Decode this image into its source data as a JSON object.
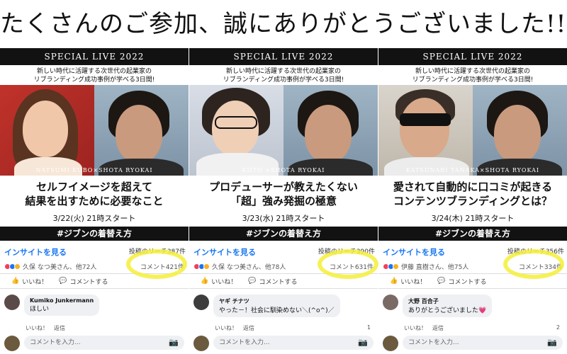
{
  "headline": "たくさんのご参加、誠にありがとうございました!!!",
  "panels": [
    {
      "banner": "SPECIAL LIVE 2022",
      "sub1": "新しい時代に活躍する次世代の起業家の",
      "sub2": "リブランディング成功事例が学べる3日間!",
      "names": "NATSUMI KUBO×SHOTA RYOKAI",
      "title1": "セルフイメージを超えて",
      "title2": "結果を出すために必要なこと",
      "date": "3/22(火) 21時スタート",
      "hashtag": "#ジブンの着替え方",
      "insight": "インサイトを見る",
      "reach": "投稿のリーチ387件",
      "reactors": "久保 なつ美さん、他72人",
      "comment_count": "コメント421件",
      "like": "いいね！",
      "comment_action": "コメントする",
      "commenter": "Kumiko Junkermann",
      "comment_text": "ほしい",
      "reply_like": "いいね！",
      "reply": "返信",
      "reply_count": "",
      "input_placeholder": "コメントを入力..."
    },
    {
      "banner": "SPECIAL LIVE 2022",
      "sub1": "新しい時代に活躍する次世代の起業家の",
      "sub2": "リブランディング成功事例が学べる3日間!",
      "names": "KIITO ×SHOTA RYOKAI",
      "title1": "プロデューサーが教えたくない",
      "title2": "「超」強み発掘の極意",
      "date": "3/23(水) 21時スタート",
      "hashtag": "#ジブンの着替え方",
      "insight": "インサイトを見る",
      "reach": "投稿のリーチ390件",
      "reactors": "久保 なつ美さん、他78人",
      "comment_count": "コメント631件",
      "like": "いいね！",
      "comment_action": "コメントする",
      "commenter": "ヤギ チナツ",
      "comment_text": "やった－！社会に馴染めない＼(^o^)／",
      "reply_like": "いいね！",
      "reply": "返信",
      "reply_count": "1",
      "input_placeholder": "コメントを入力..."
    },
    {
      "banner": "SPECIAL LIVE 2022",
      "sub1": "新しい時代に活躍する次世代の起業家の",
      "sub2": "リブランディング成功事例が学べる3日間!",
      "names": "KATSUNARI TANAKA×SHOTA RYOKAI",
      "title1": "愛されて自動的に口コミが起きる",
      "title2": "コンテンツブランディングとは？",
      "date": "3/24(木) 21時スタート",
      "hashtag": "#ジブンの着替え方",
      "insight": "インサイトを見る",
      "reach": "投稿のリーチ356件",
      "reactors": "伊藤 直樹さん、他75人",
      "comment_count": "コメント334件",
      "like": "いいね！",
      "comment_action": "コメントする",
      "commenter": "大野 百合子",
      "comment_text": "ありがとうございました💗",
      "reply_like": "いいね！",
      "reply": "返信",
      "reply_count": "2",
      "input_placeholder": "コメントを入力..."
    }
  ],
  "colors": {
    "accent": "#1877f2",
    "highlight": "#f5ee3a",
    "banner": "#121212"
  }
}
